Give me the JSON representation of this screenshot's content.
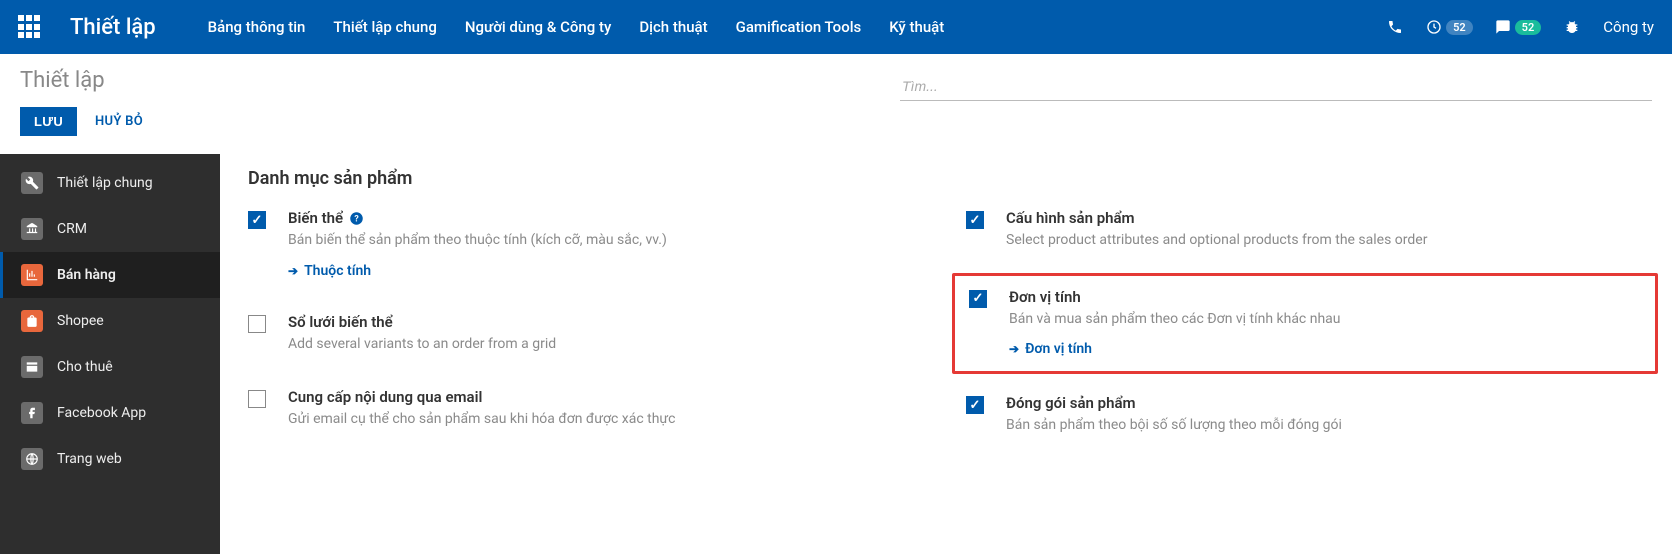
{
  "header": {
    "brand": "Thiết lập",
    "menu": [
      "Bảng thông tin",
      "Thiết lập chung",
      "Người dùng & Công ty",
      "Dịch thuật",
      "Gamification Tools",
      "Kỹ thuật"
    ],
    "badge1": "52",
    "badge2": "52",
    "company": "Công ty"
  },
  "subhead": {
    "breadcrumb": "Thiết lập",
    "save": "LƯU",
    "discard": "HUỶ BỎ",
    "search_placeholder": "Tìm..."
  },
  "sidebar": {
    "items": [
      {
        "label": "Thiết lập chung"
      },
      {
        "label": "CRM"
      },
      {
        "label": "Bán hàng"
      },
      {
        "label": "Shopee"
      },
      {
        "label": "Cho thuê"
      },
      {
        "label": "Facebook App"
      },
      {
        "label": "Trang web"
      }
    ]
  },
  "content": {
    "section_title": "Danh mục sản phẩm",
    "left_col": [
      {
        "title": "Biến thể",
        "help": true,
        "desc": "Bán biến thể sản phẩm theo thuộc tính (kích cỡ, màu sắc, vv.)",
        "link": "Thuộc tính",
        "checked": true
      },
      {
        "title": "Sổ lưới biến thể",
        "desc": "Add several variants to an order from a grid",
        "checked": false
      },
      {
        "title": "Cung cấp nội dung qua email",
        "desc": "Gửi email cụ thể cho sản phẩm sau khi hóa đơn được xác thực",
        "checked": false
      }
    ],
    "right_col": [
      {
        "title": "Cấu hình sản phẩm",
        "desc": "Select product attributes and optional products from the sales order",
        "checked": true
      },
      {
        "title": "Đơn vị tính",
        "desc": "Bán và mua sản phẩm theo các Đơn vị tính khác nhau",
        "link": "Đơn vị tính",
        "checked": true,
        "highlight": true
      },
      {
        "title": "Đóng gói sản phẩm",
        "desc": "Bán sản phẩm theo bội số số lượng theo mỗi đóng gói",
        "checked": true
      }
    ]
  }
}
